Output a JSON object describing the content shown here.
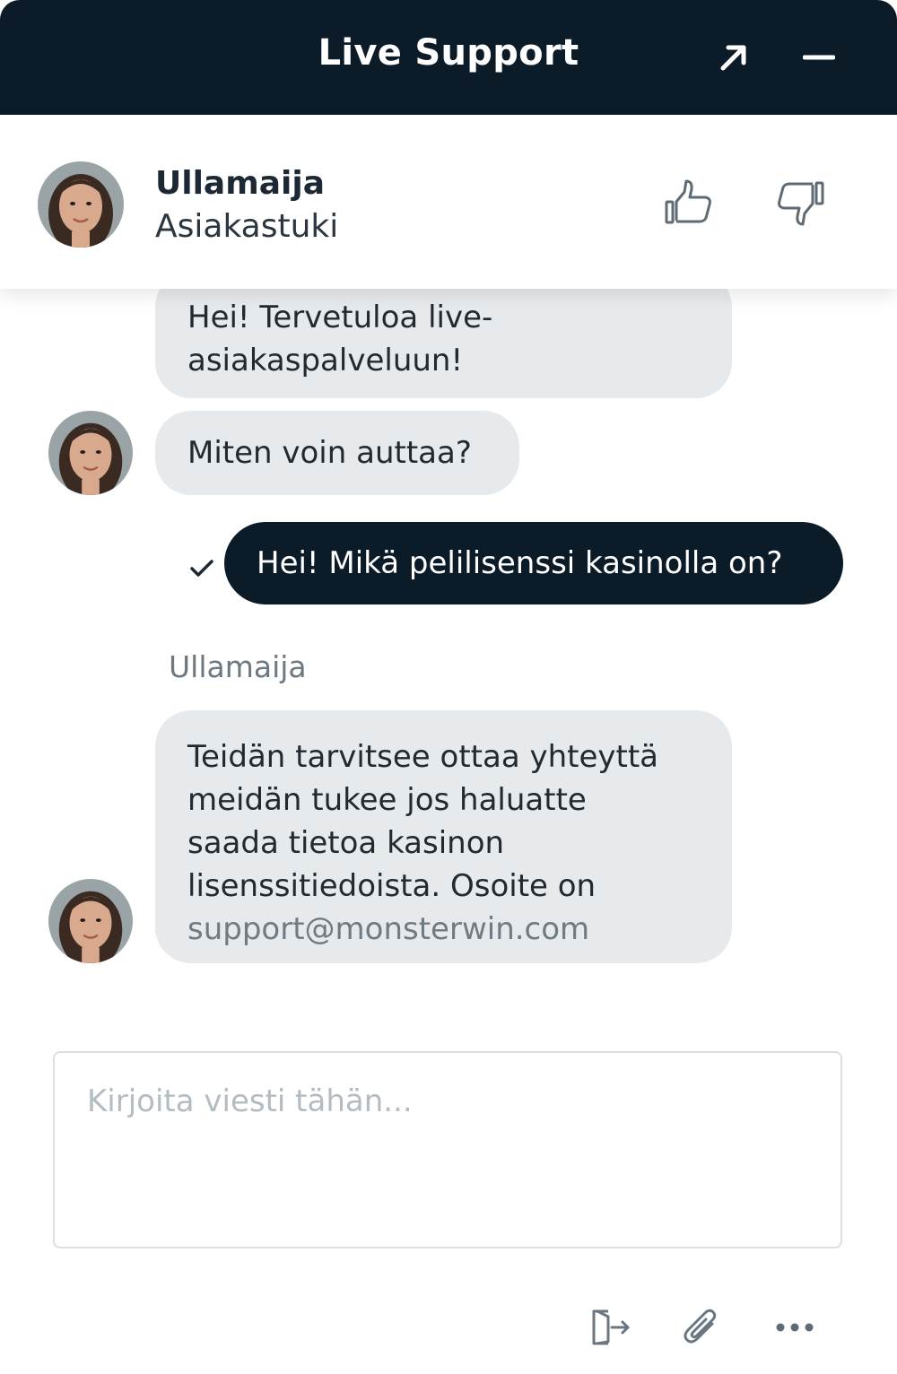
{
  "header": {
    "title": "Live Support",
    "expand_icon": "arrow-up-right-icon",
    "minimize_icon": "minimize-icon"
  },
  "agent": {
    "name": "Ullamaija",
    "role": "Asiakastuki",
    "avatar_icon": "agent-avatar",
    "rate_up_icon": "thumbs-up-icon",
    "rate_down_icon": "thumbs-down-icon"
  },
  "messages": [
    {
      "from": "agent",
      "lines": [
        "Hei! Tervetuloa live-",
        "asiakaspalveluun!"
      ]
    },
    {
      "from": "agent",
      "lines": [
        "Miten voin auttaa?"
      ]
    },
    {
      "from": "user",
      "text": "Hei! Mikä pelilisenssi kasinolla on?",
      "status_icon": "checkmark-icon"
    },
    {
      "from": "agent",
      "sender": "Ullamaija",
      "lines": [
        "Teidän tarvitsee ottaa yhteyttä",
        "meidän tukee jos haluatte",
        "saada tietoa kasinon",
        "lisenssitiedoista. Osoite on"
      ],
      "link": "support@monsterwin.com"
    }
  ],
  "composer": {
    "placeholder": "Kirjoita viesti tähän..."
  },
  "toolbar": {
    "end_chat_icon": "exit-icon",
    "attach_icon": "paperclip-icon",
    "more_icon": "more-dots-icon"
  },
  "colors": {
    "header_bg": "#0c1b28",
    "agent_bubble": "#e7eaec",
    "user_bubble": "#0c1b28",
    "icon_gray": "#6b7780"
  }
}
